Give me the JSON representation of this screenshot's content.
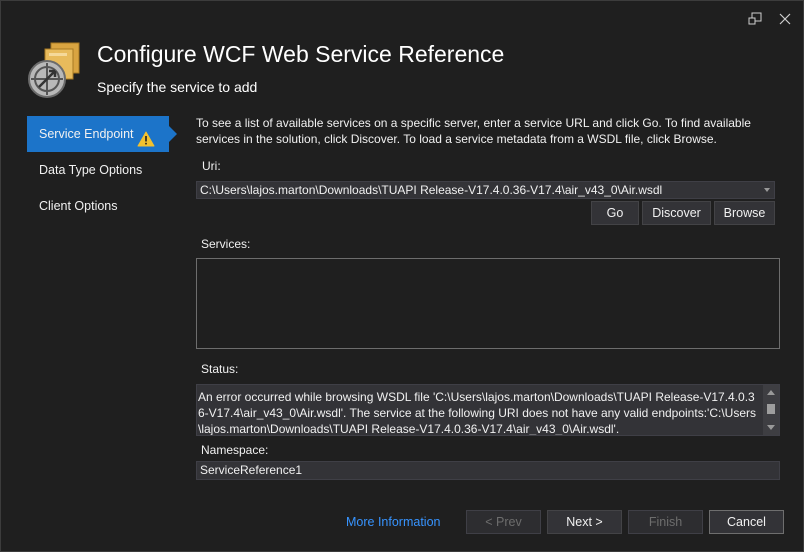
{
  "titlebar": {
    "icons": [
      "pin-window-icon",
      "close-icon"
    ]
  },
  "header": {
    "title": "Configure WCF Web Service Reference",
    "subtitle": "Specify the service to add"
  },
  "sidebar": {
    "items": [
      {
        "label": "Service Endpoint",
        "active": true,
        "warning": true
      },
      {
        "label": "Data Type Options",
        "active": false
      },
      {
        "label": "Client Options",
        "active": false
      }
    ]
  },
  "main": {
    "description": "To see a list of available services on a specific server, enter a service URL and click Go. To find available services in the solution, click Discover.  To load a service metadata from a WSDL file, click Browse.",
    "uri_label": "Uri:",
    "uri_value": "C:\\Users\\lajos.marton\\Downloads\\TUAPI Release-V17.4.0.36-V17.4\\air_v43_0\\Air.wsdl",
    "go_label": "Go",
    "discover_label": "Discover",
    "browse_label": "Browse",
    "services_label": "Services:",
    "status_label": "Status:",
    "status_text": "An error occurred while browsing WSDL file 'C:\\Users\\lajos.marton\\Downloads\\TUAPI Release-V17.4.0.36-V17.4\\air_v43_0\\Air.wsdl'. The service at the following URI does not have any valid endpoints:'C:\\Users\\lajos.marton\\Downloads\\TUAPI Release-V17.4.0.36-V17.4\\air_v43_0\\Air.wsdl'.",
    "namespace_label": "Namespace:",
    "namespace_value": "ServiceReference1"
  },
  "footer": {
    "more_info": "More Information",
    "prev": "< Prev",
    "next": "Next >",
    "finish": "Finish",
    "cancel": "Cancel"
  },
  "colors": {
    "accent": "#1c74c9",
    "link": "#3794ff",
    "warning": "#f2c12e"
  }
}
